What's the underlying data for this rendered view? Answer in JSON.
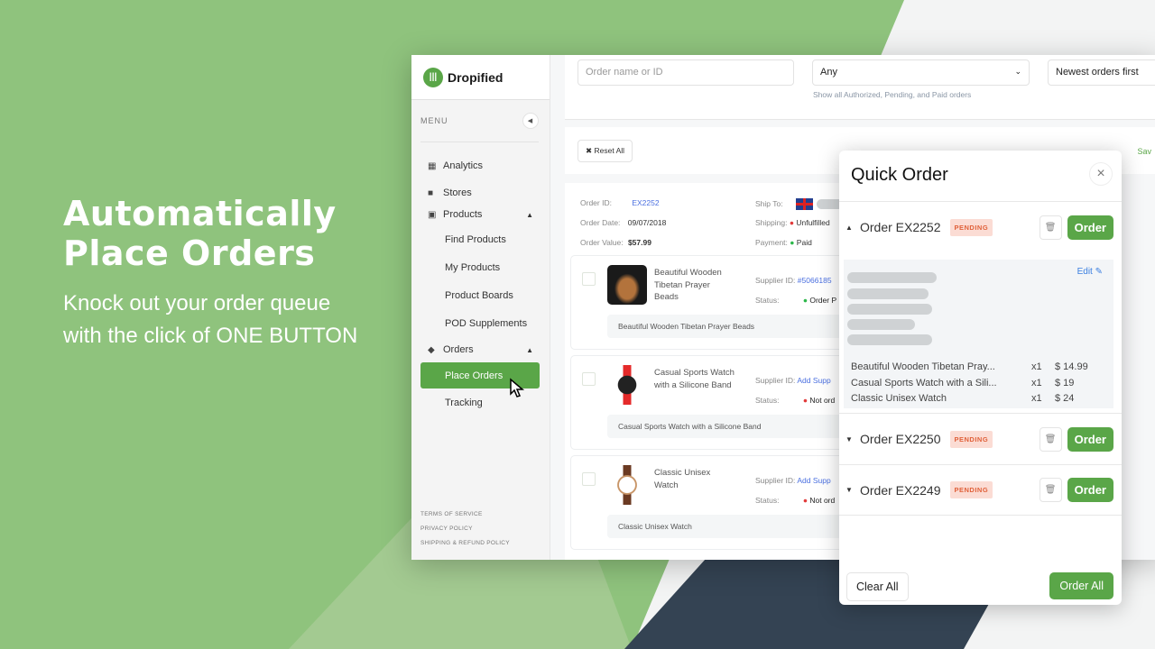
{
  "colors": {
    "bg_green": "#8fc37d",
    "bg_green_light": "#a3ca91",
    "bg_navy": "#344353",
    "brand": "#5aa648",
    "pending_bg": "#fbdcd4",
    "pending_text": "#e0613a",
    "link": "#4a6fe0"
  },
  "hero": {
    "title_line1": "Automatically",
    "title_line2": "Place Orders",
    "sub_line1": "Knock out your order queue",
    "sub_line2": "with the click of ONE BUTTON"
  },
  "sidebar": {
    "brand": "Dropified",
    "menu_label": "MENU",
    "items": [
      {
        "label": "Analytics",
        "icon": "presentation-chart-icon"
      },
      {
        "label": "Stores",
        "icon": "store-icon"
      },
      {
        "label": "Products",
        "icon": "products-icon"
      },
      {
        "label": "Find Products"
      },
      {
        "label": "My Products"
      },
      {
        "label": "Product Boards"
      },
      {
        "label": "POD Supplements"
      },
      {
        "label": "Orders",
        "icon": "box-icon"
      },
      {
        "label": "Place Orders",
        "active": true
      },
      {
        "label": "Tracking"
      }
    ],
    "footer": [
      "TERMS OF SERVICE",
      "PRIVACY POLICY",
      "SHIPPING & REFUND POLICY"
    ]
  },
  "filters": {
    "search_placeholder": "Order name or ID",
    "status_value": "Any",
    "status_hint": "Show all Authorized, Pending, and Paid orders",
    "sort_value": "Newest orders first",
    "reset_label": "Reset All",
    "save_label": "Sav"
  },
  "order": {
    "id_label": "Order ID:",
    "id": "EX2252",
    "date_label": "Order Date:",
    "date": "09/07/2018",
    "value_label": "Order Value:",
    "value": "$57.99",
    "ship_label": "Ship To:",
    "shipping_label": "Shipping:",
    "shipping": "Unfulfilled",
    "payment_label": "Payment:",
    "payment": "Paid",
    "items": [
      {
        "name": "Beautiful Wooden Tibetan Prayer Beads",
        "supplier_label": "Supplier ID:",
        "supplier": "#5066185",
        "status_label": "Status:",
        "status": "Order P",
        "status_color": "#2db84b"
      },
      {
        "name": "Casual Sports Watch with a Silicone Band",
        "supplier_label": "Supplier ID:",
        "supplier": "Add Supp",
        "status_label": "Status:",
        "status": "Not ord",
        "status_color": "#e23b3b"
      },
      {
        "name": "Classic Unisex Watch",
        "supplier_label": "Supplier ID:",
        "supplier": "Add Supp",
        "status_label": "Status:",
        "status": "Not ord",
        "status_color": "#e23b3b"
      }
    ]
  },
  "quick_order": {
    "title": "Quick Order",
    "edit_label": "Edit",
    "order_btn": "Order",
    "clear_all": "Clear All",
    "order_all": "Order All",
    "orders": [
      {
        "title": "Order EX2252",
        "badge": "PENDING",
        "expanded": true
      },
      {
        "title": "Order EX2250",
        "badge": "PENDING"
      },
      {
        "title": "Order EX2249",
        "badge": "PENDING"
      }
    ],
    "line_items": [
      {
        "name": "Beautiful Wooden Tibetan Pray...",
        "qty": "x1",
        "price": "$ 14.99"
      },
      {
        "name": "Casual Sports Watch with a Sili...",
        "qty": "x1",
        "price": "$ 19"
      },
      {
        "name": "Classic Unisex Watch",
        "qty": "x1",
        "price": "$ 24"
      }
    ]
  }
}
